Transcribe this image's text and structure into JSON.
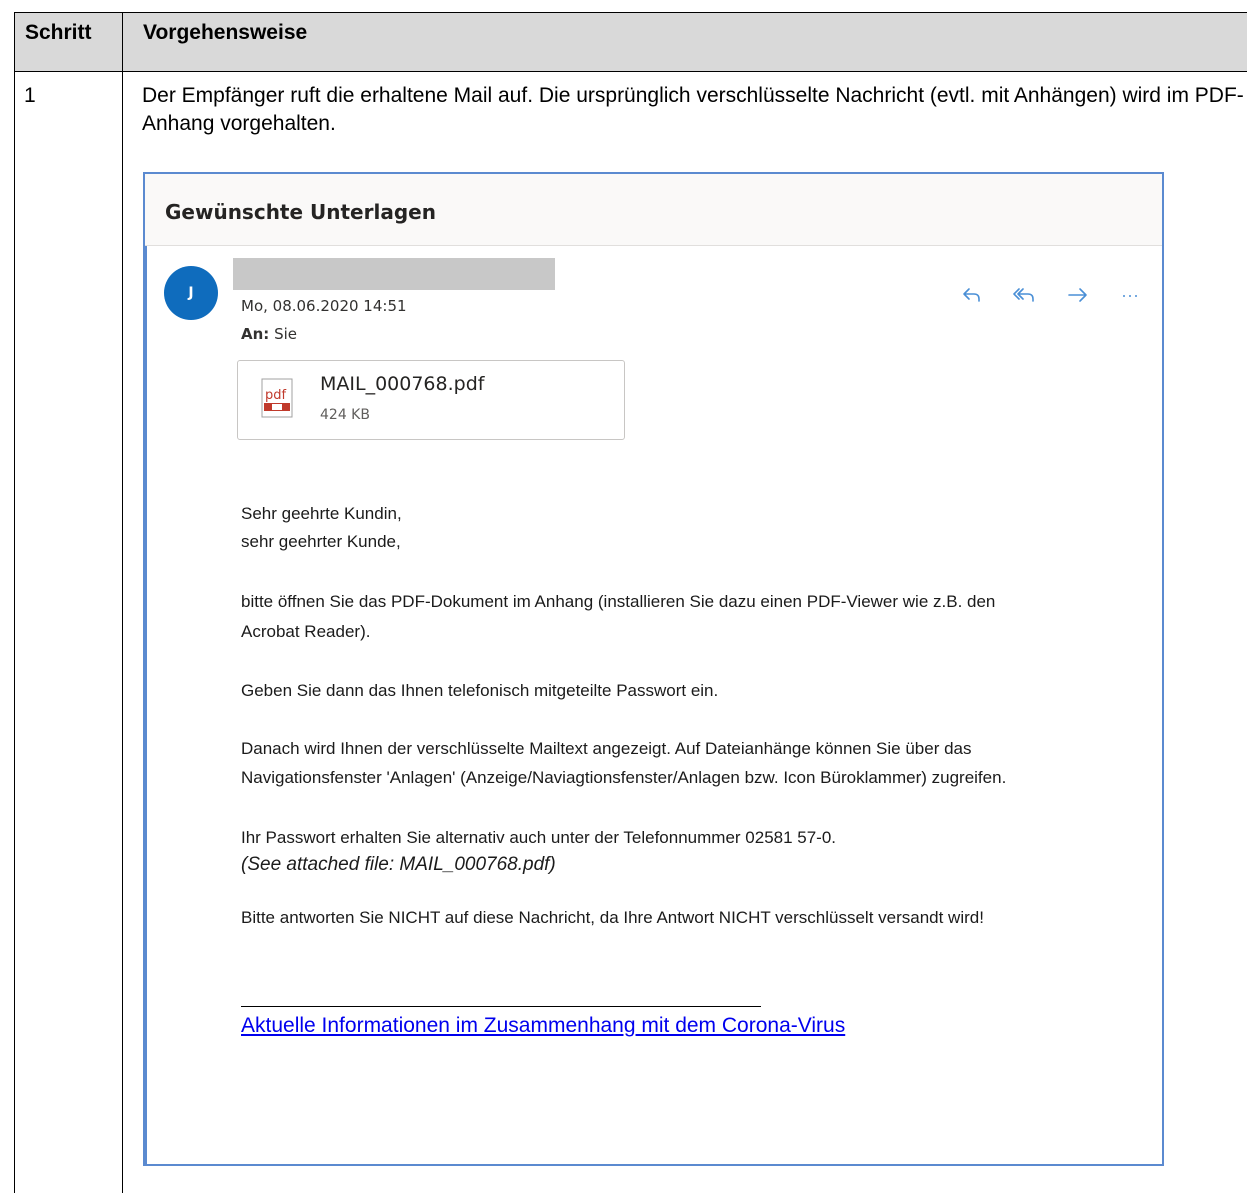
{
  "table": {
    "header_step": "Schritt",
    "header_procedure": "Vorgehensweise",
    "row1_step": "1",
    "row1_text": "Der Empfänger ruft die erhaltene Mail auf. Die ursprünglich verschlüsselte Nachricht (evtl. mit Anhängen) wird im PDF-Anhang vorgehalten."
  },
  "email": {
    "subject": "Gewünschte Unterlagen",
    "avatar_initial": "J",
    "date": "Mo, 08.06.2020 14:51",
    "to_label": "An:",
    "to_value": "Sie",
    "actions": {
      "reply_icon": "reply-icon",
      "reply_all_icon": "reply-all-icon",
      "forward_icon": "forward-icon",
      "more_icon": "more-icon"
    },
    "attachment": {
      "icon": "pdf-file-icon",
      "name": "MAIL_000768.pdf",
      "size": "424 KB"
    },
    "body": {
      "greeting1": "Sehr geehrte Kundin,",
      "greeting2": "sehr geehrter Kunde,",
      "p1_line1": "bitte öffnen Sie das PDF-Dokument im Anhang (installieren Sie dazu einen PDF-Viewer wie z.B. den",
      "p1_line2": "Acrobat Reader).",
      "p2": "Geben Sie dann das Ihnen telefonisch mitgeteilte Passwort ein.",
      "p3_line1": "Danach wird Ihnen der verschlüsselte Mailtext angezeigt. Auf Dateianhänge können Sie über das",
      "p3_line2": "Navigationsfenster 'Anlagen' (Anzeige/Naviagtionsfenster/Anlagen bzw. Icon Büroklammer) zugreifen.",
      "p4": "Ihr Passwort erhalten Sie alternativ auch unter der Telefonnummer 02581 57-0.",
      "p4_attached": "(See attached file: MAIL_000768.pdf)",
      "p5": "Bitte antworten Sie NICHT auf diese Nachricht, da Ihre Antwort NICHT verschlüsselt versandt wird!",
      "link": "Aktuelle Informationen im Zusammenhang mit dem Corona-Virus"
    }
  },
  "colors": {
    "header_bg": "#d9d9d9",
    "frame_blue": "#5b8ad0",
    "avatar_blue": "#0f6cbd",
    "link_blue": "#0000ee",
    "pdf_red": "#c0392b"
  }
}
